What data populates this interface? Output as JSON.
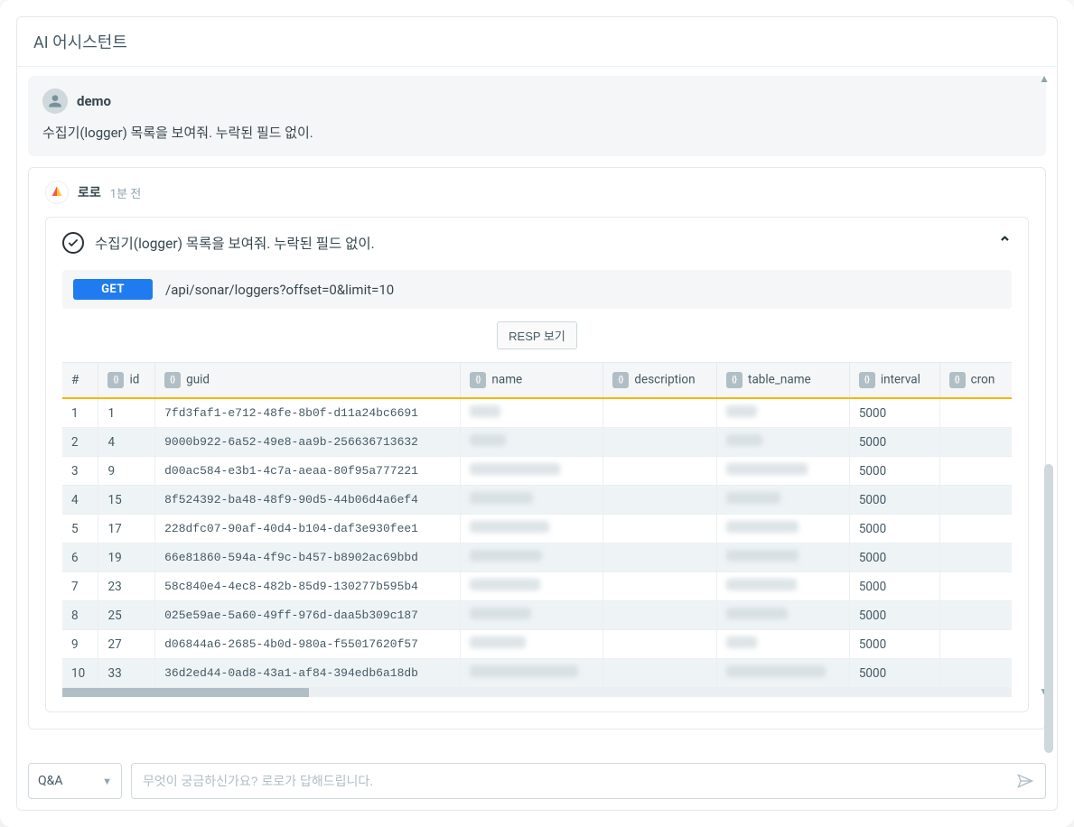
{
  "header": {
    "title": "AI 어시스턴트"
  },
  "user_msg": {
    "name": "demo",
    "text": "수집기(logger) 목록을 보여줘. 누락된 필드 없이."
  },
  "bot_msg": {
    "name": "로로",
    "time": "1분 전",
    "task_title": "수집기(logger) 목록을 보여줘. 누락된 필드 없이.",
    "method": "GET",
    "url": "/api/sonar/loggers?offset=0&limit=10",
    "resp_button": "RESP 보기"
  },
  "table": {
    "columns": [
      "#",
      "id",
      "guid",
      "name",
      "description",
      "table_name",
      "interval",
      "cron"
    ],
    "col_types": [
      "",
      "{}",
      "{}",
      "{}",
      "{}",
      "{}",
      "{}",
      "{}"
    ],
    "rows": [
      {
        "n": "1",
        "id": "1",
        "guid": "7fd3faf1-e712-48fe-8b0f-d11a24bc6691",
        "name_w": 34,
        "desc_w": 0,
        "tbl_w": 34,
        "interval": "5000"
      },
      {
        "n": "2",
        "id": "4",
        "guid": "9000b922-6a52-49e8-aa9b-256636713632",
        "name_w": 40,
        "desc_w": 0,
        "tbl_w": 40,
        "interval": "5000"
      },
      {
        "n": "3",
        "id": "9",
        "guid": "d00ac584-e3b1-4c7a-aeaa-80f95a777221",
        "name_w": 100,
        "desc_w": 0,
        "tbl_w": 90,
        "interval": "5000"
      },
      {
        "n": "4",
        "id": "15",
        "guid": "8f524392-ba48-48f9-90d5-44b06d4a6ef4",
        "name_w": 70,
        "desc_w": 0,
        "tbl_w": 60,
        "interval": "5000"
      },
      {
        "n": "5",
        "id": "17",
        "guid": "228dfc07-90af-40d4-b104-daf3e930fee1",
        "name_w": 88,
        "desc_w": 0,
        "tbl_w": 80,
        "interval": "5000"
      },
      {
        "n": "6",
        "id": "19",
        "guid": "66e81860-594a-4f9c-b457-b8902ac69bbd",
        "name_w": 80,
        "desc_w": 0,
        "tbl_w": 80,
        "interval": "5000"
      },
      {
        "n": "7",
        "id": "23",
        "guid": "58c840e4-4ec8-482b-85d9-130277b595b4",
        "name_w": 78,
        "desc_w": 0,
        "tbl_w": 78,
        "interval": "5000"
      },
      {
        "n": "8",
        "id": "25",
        "guid": "025e59ae-5a60-49ff-976d-daa5b309c187",
        "name_w": 68,
        "desc_w": 0,
        "tbl_w": 68,
        "interval": "5000"
      },
      {
        "n": "9",
        "id": "27",
        "guid": "d06844a6-2685-4b0d-980a-f55017620f57",
        "name_w": 62,
        "desc_w": 0,
        "tbl_w": 34,
        "interval": "5000"
      },
      {
        "n": "10",
        "id": "33",
        "guid": "36d2ed44-0ad8-43a1-af84-394edb6a18db",
        "name_w": 120,
        "desc_w": 0,
        "tbl_w": 110,
        "interval": "5000"
      }
    ]
  },
  "input": {
    "mode": "Q&A",
    "placeholder": "무엇이 궁금하신가요? 로로가 답해드립니다."
  }
}
